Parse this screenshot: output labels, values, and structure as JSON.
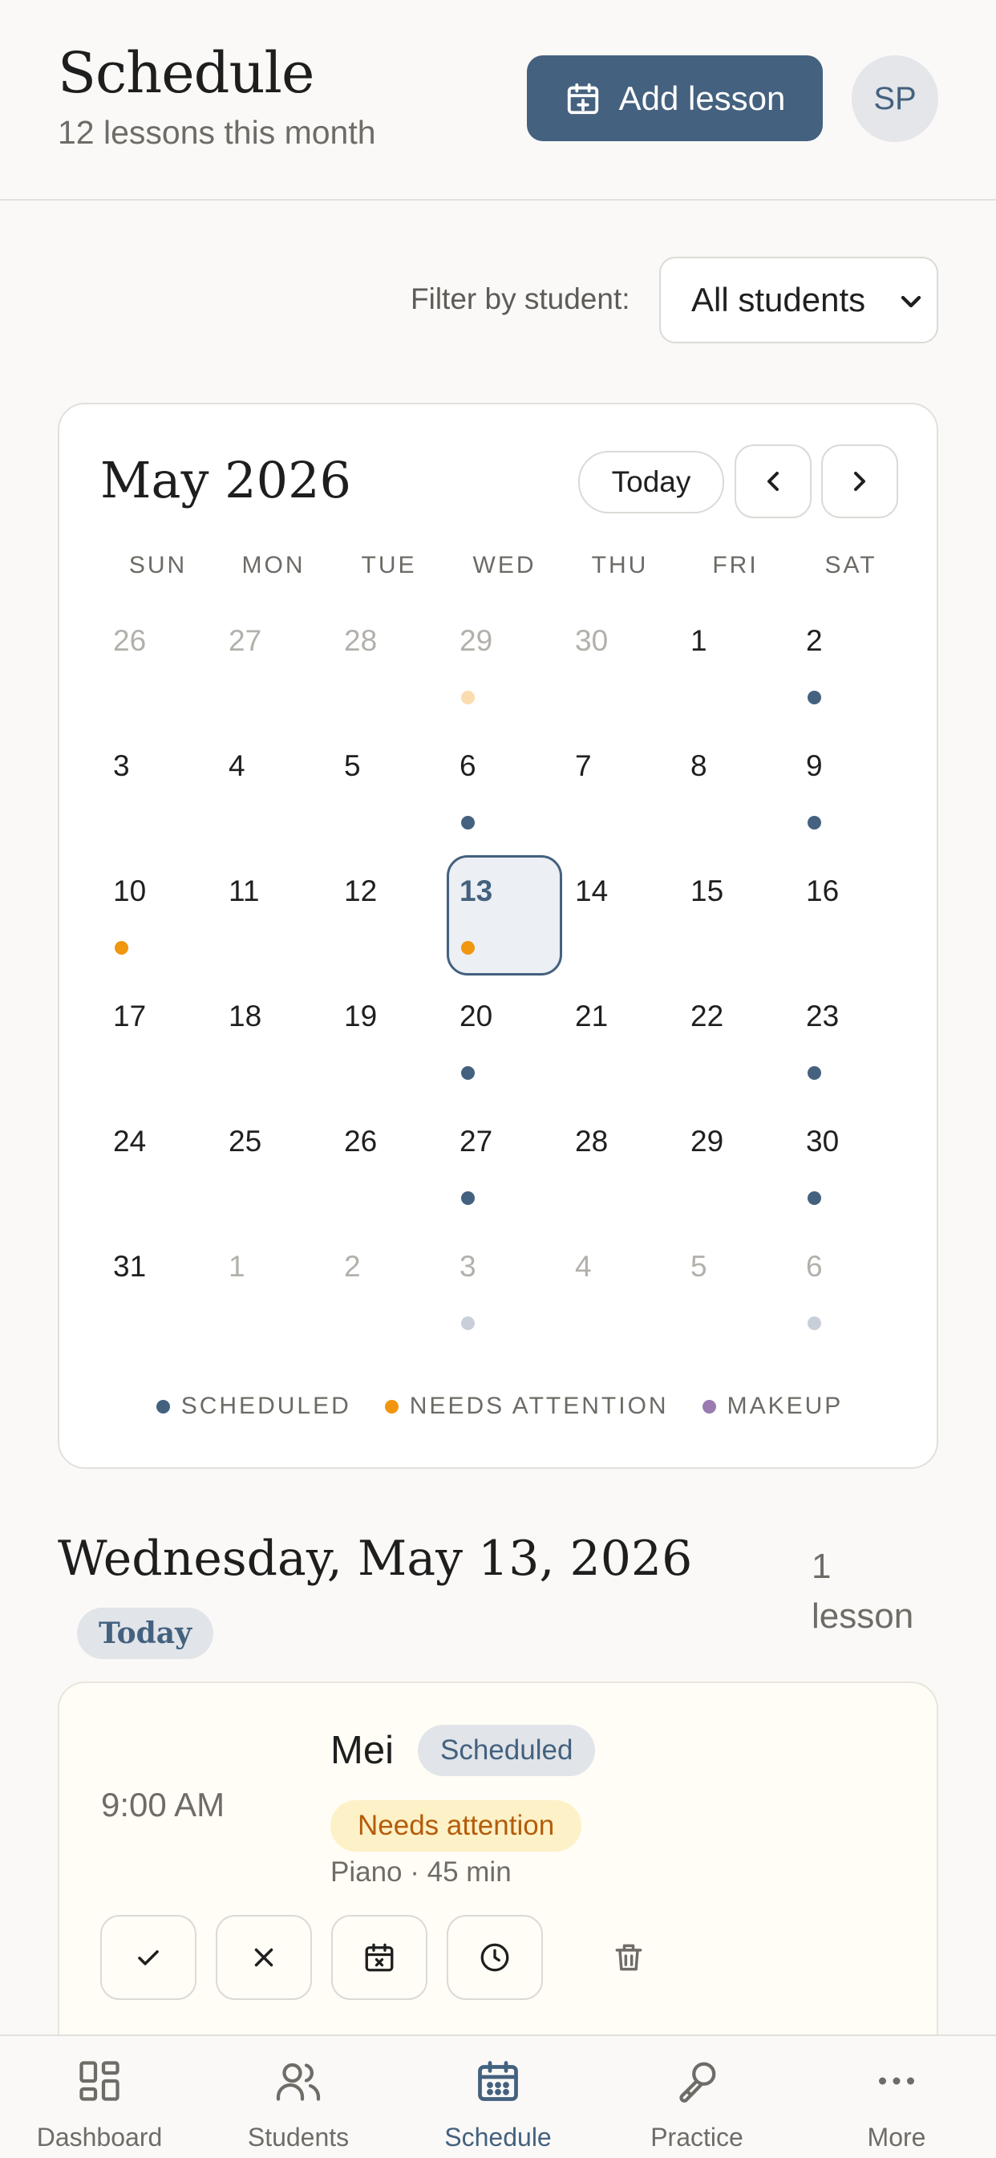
{
  "header": {
    "title": "Schedule",
    "subtitle": "12 lessons this month",
    "add_button": "Add lesson",
    "avatar": "SP"
  },
  "filter": {
    "label": "Filter by student:",
    "selected": "All students"
  },
  "calendar": {
    "month": "May 2026",
    "today_button": "Today",
    "weekdays": [
      "SUN",
      "MON",
      "TUE",
      "WED",
      "THU",
      "FRI",
      "SAT"
    ],
    "days": [
      {
        "n": "26",
        "out": true
      },
      {
        "n": "27",
        "out": true
      },
      {
        "n": "28",
        "out": true
      },
      {
        "n": "29",
        "out": true,
        "dot": "attention-faded"
      },
      {
        "n": "30",
        "out": true
      },
      {
        "n": "1"
      },
      {
        "n": "2",
        "dot": "scheduled"
      },
      {
        "n": "3"
      },
      {
        "n": "4"
      },
      {
        "n": "5"
      },
      {
        "n": "6",
        "dot": "scheduled"
      },
      {
        "n": "7"
      },
      {
        "n": "8"
      },
      {
        "n": "9",
        "dot": "scheduled"
      },
      {
        "n": "10",
        "dot": "attention"
      },
      {
        "n": "11"
      },
      {
        "n": "12"
      },
      {
        "n": "13",
        "dot": "attention",
        "selected": true
      },
      {
        "n": "14"
      },
      {
        "n": "15"
      },
      {
        "n": "16"
      },
      {
        "n": "17"
      },
      {
        "n": "18"
      },
      {
        "n": "19"
      },
      {
        "n": "20",
        "dot": "scheduled"
      },
      {
        "n": "21"
      },
      {
        "n": "22"
      },
      {
        "n": "23",
        "dot": "scheduled"
      },
      {
        "n": "24"
      },
      {
        "n": "25"
      },
      {
        "n": "26"
      },
      {
        "n": "27",
        "dot": "scheduled"
      },
      {
        "n": "28"
      },
      {
        "n": "29"
      },
      {
        "n": "30",
        "dot": "scheduled"
      },
      {
        "n": "31"
      },
      {
        "n": "1",
        "out": true
      },
      {
        "n": "2",
        "out": true
      },
      {
        "n": "3",
        "out": true,
        "dot": "scheduled-faded"
      },
      {
        "n": "4",
        "out": true
      },
      {
        "n": "5",
        "out": true
      },
      {
        "n": "6",
        "out": true,
        "dot": "scheduled-faded"
      }
    ],
    "legend": [
      {
        "label": "SCHEDULED",
        "color": "#44617f"
      },
      {
        "label": "NEEDS ATTENTION",
        "color": "#f0960f"
      },
      {
        "label": "MAKEUP",
        "color": "#9a7bb0"
      }
    ],
    "dot_colors": {
      "scheduled": "#44617f",
      "attention": "#f0960f",
      "attention-faded": "#fbdcae",
      "scheduled-faded": "#c9cfd8"
    }
  },
  "day_view": {
    "title": "Wednesday, May 13, 2026",
    "today_badge": "Today",
    "count": "1 lesson"
  },
  "lesson": {
    "time": "9:00 AM",
    "student": "Mei",
    "status": "Scheduled",
    "flag": "Needs attention",
    "meta": "Piano · 45 min",
    "actions": [
      "check-icon",
      "close-icon",
      "calendar-x-icon",
      "clock-icon",
      "trash-icon"
    ]
  },
  "bottom_nav": [
    {
      "label": "Dashboard",
      "icon": "dashboard-icon"
    },
    {
      "label": "Students",
      "icon": "students-icon"
    },
    {
      "label": "Schedule",
      "icon": "calendar-icon",
      "active": true
    },
    {
      "label": "Practice",
      "icon": "microphone-icon"
    },
    {
      "label": "More",
      "icon": "more-icon"
    }
  ],
  "colors": {
    "accent": "#44617f",
    "background": "#faf9f7",
    "attention_bg": "#fdf1c7",
    "attention_text": "#b45c0a"
  }
}
